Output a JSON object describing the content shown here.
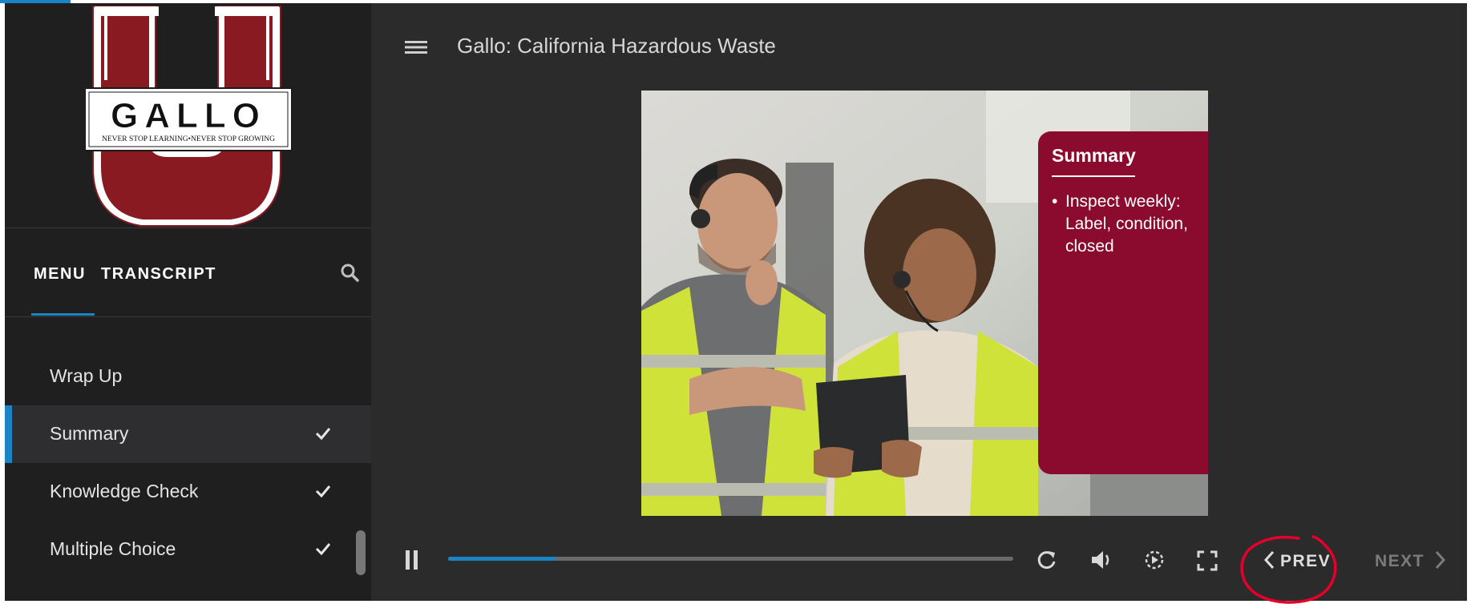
{
  "course": {
    "title": "Gallo: California Hazardous Waste"
  },
  "logo": {
    "wordmark": "GALLO",
    "tagline": "NEVER STOP LEARNING•NEVER STOP GROWING"
  },
  "sidebar": {
    "tabs": [
      {
        "label": "MENU",
        "selected": true
      },
      {
        "label": "TRANSCRIPT",
        "selected": false
      }
    ],
    "search_icon": "search-icon",
    "items": [
      {
        "label": "Wrap Up",
        "completed": false,
        "active": false
      },
      {
        "label": "Summary",
        "completed": true,
        "active": true
      },
      {
        "label": "Knowledge Check",
        "completed": true,
        "active": false
      },
      {
        "label": "Multiple Choice",
        "completed": true,
        "active": false
      }
    ]
  },
  "slide": {
    "panel_title": "Summary",
    "bullets": [
      "Inspect weekly: Label, condition, closed"
    ]
  },
  "player": {
    "progress": 0.19,
    "prev_label": "PREV",
    "next_label": "NEXT",
    "next_enabled": false
  },
  "colors": {
    "accent": "#1a84c6",
    "brand_red": "#8a0b2e",
    "sidebar_bg": "#1f1f20",
    "main_bg": "#2b2b2c",
    "annotation": "#e4002b"
  }
}
